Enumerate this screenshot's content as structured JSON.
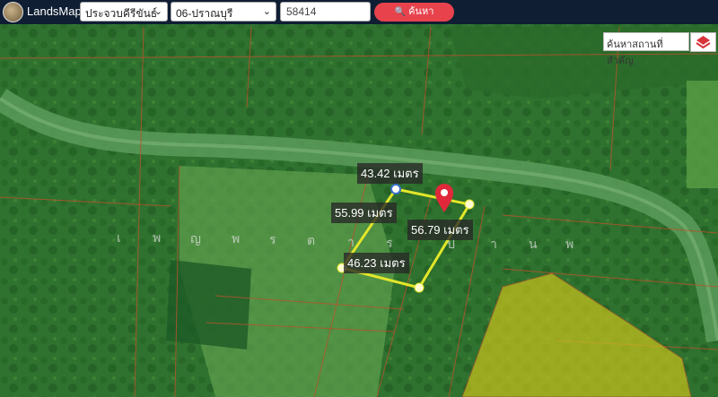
{
  "header": {
    "brand": "LandsMaps",
    "province": "ประจวบคีรีขันธ์",
    "district": "06-ปราณบุรี",
    "parcel_number": "58414",
    "search_button": "ค้นหา"
  },
  "map_search": {
    "placeholder": "ค้นหาสถานที่สำคัญ"
  },
  "measurements": {
    "top": "43.42 เมตร",
    "left": "55.99 เมตร",
    "right": "56.79 เมตร",
    "bottom": "46.23 เมตร"
  },
  "road_label_letters": [
    "เ",
    "พ",
    "ญ",
    "พ",
    "ร",
    "ต",
    "า",
    "ร",
    "ป",
    "า",
    "น",
    "พ"
  ],
  "colors": {
    "accent": "#e8434d",
    "header_bg": "#0f1e33",
    "parcel_outline": "#e3e62a",
    "marker": "#e0283a",
    "zone_fill": "#c9c21c"
  }
}
